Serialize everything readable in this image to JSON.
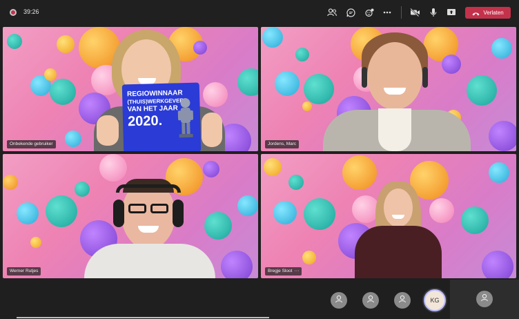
{
  "meeting": {
    "timer": "39:26"
  },
  "toolbar": {
    "leave_label": "Verlaten",
    "icons": [
      "people-icon",
      "chat-icon",
      "reactions-icon",
      "more-icon",
      "camera-off-icon",
      "mic-icon",
      "share-icon",
      "phone-icon"
    ],
    "leave_color": "#c4314b"
  },
  "tiles": [
    {
      "name": "Onbekende gebruiker"
    },
    {
      "name": "Jordens, Marc"
    },
    {
      "name": "Werner Rutjes"
    },
    {
      "name": "Bregje Sloot",
      "more": "···"
    }
  ],
  "sign": {
    "line1": "REGIOWINNAAR",
    "line2": "(THUIS)WERKGEVER",
    "line3": "VAN HET JAAR",
    "year": "2020."
  },
  "participants": {
    "current_user_initials": "KG"
  },
  "colors": {
    "background": "#1f1f1f",
    "accent": "#b9b9ff",
    "sign_blue": "#2a3bd6"
  }
}
